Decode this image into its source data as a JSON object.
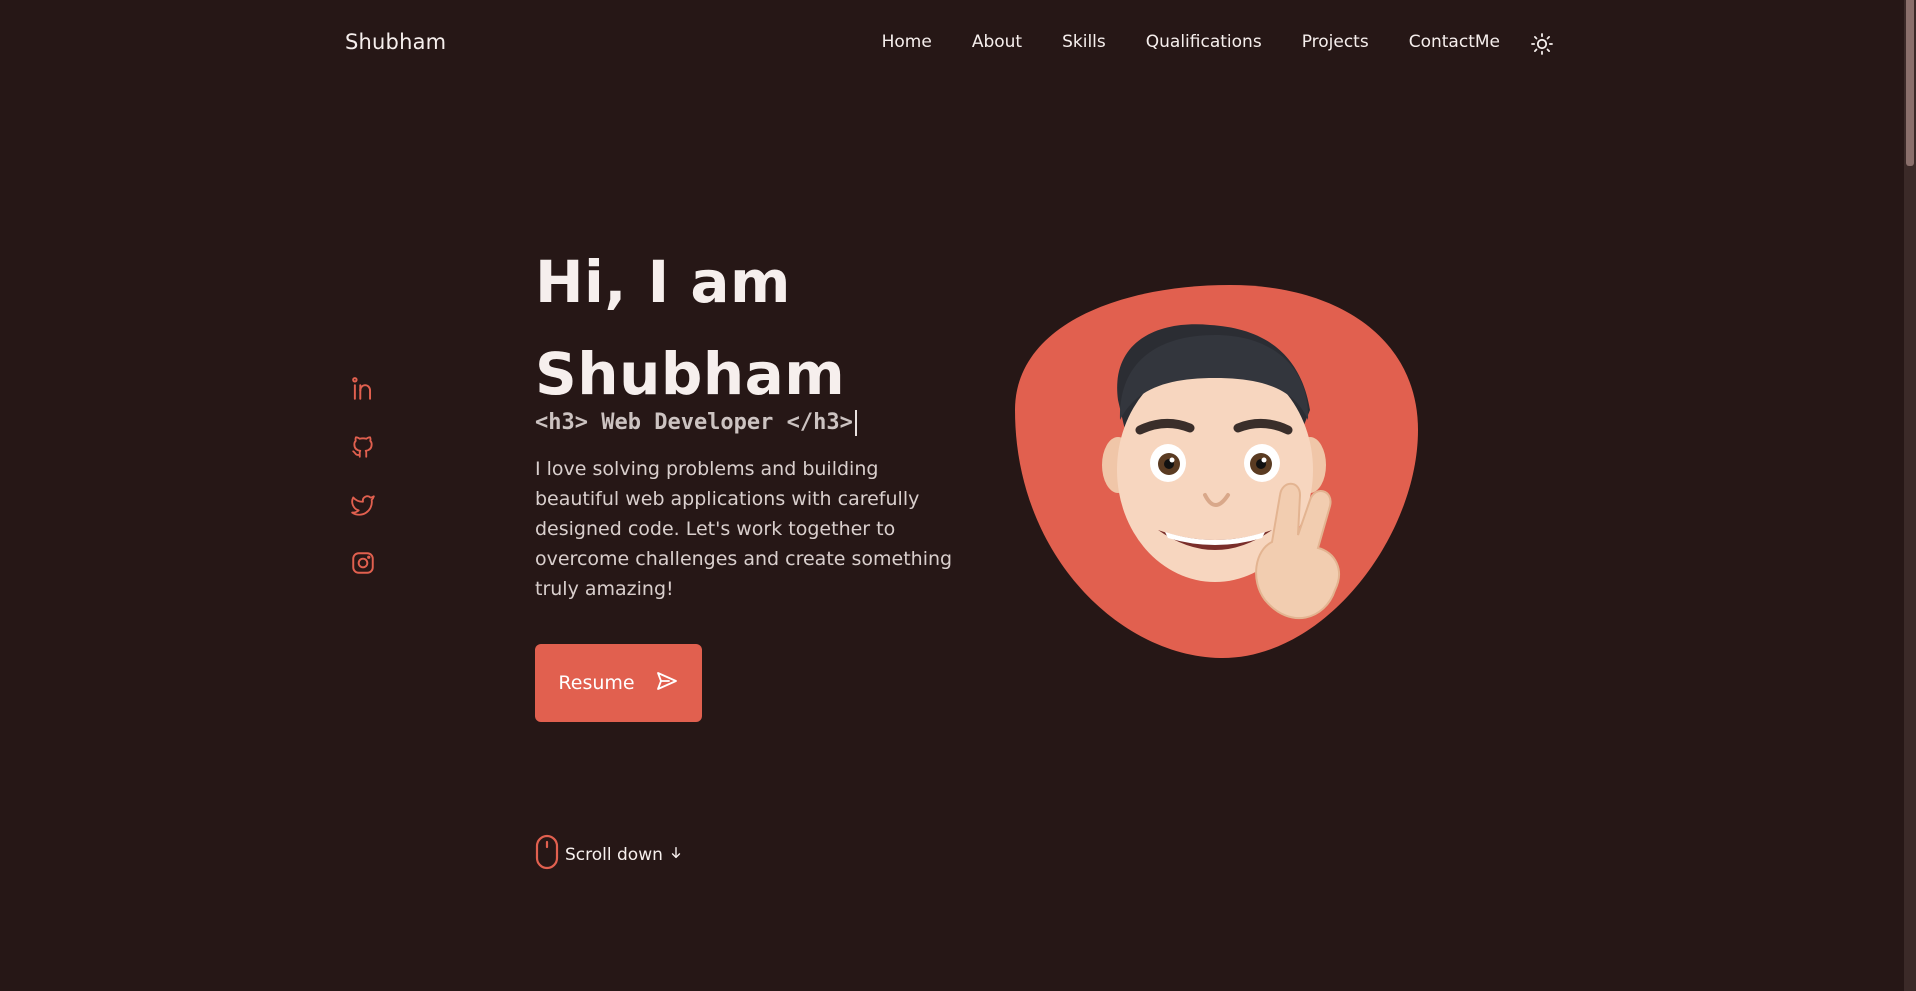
{
  "header": {
    "logo": "Shubham",
    "nav": [
      "Home",
      "About",
      "Skills",
      "Qualifications",
      "Projects",
      "ContactMe"
    ],
    "theme_icon": "sun-icon"
  },
  "social": {
    "icons": [
      "linkedin-icon",
      "github-icon",
      "twitter-icon",
      "instagram-icon"
    ]
  },
  "hero": {
    "title_line1": "Hi, I am",
    "title_line2": "Shubham",
    "subtitle": "<h3> Web Developer </h3>",
    "description": "I love solving problems and building beautiful web applications with carefully designed code. Let's work together to overcome challenges and create something truly amazing!",
    "resume_label": "Resume"
  },
  "scroll": {
    "label": "Scroll down"
  },
  "colors": {
    "background": "#261716",
    "accent": "#e1604f",
    "text": "#f6efed"
  }
}
